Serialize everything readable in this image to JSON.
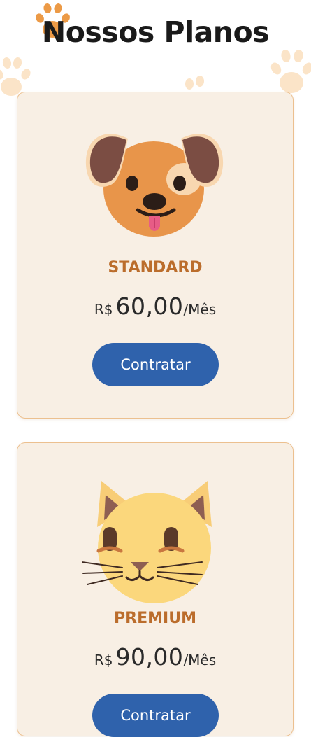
{
  "page": {
    "title": "Nossos Planos",
    "background_color": "#ffffff",
    "decorations": [
      "paw-print-icon",
      "paw-print-icon",
      "paw-print-icon",
      "paw-print-icon"
    ]
  },
  "plans": [
    {
      "icon": "dog-face-icon",
      "name": "STANDARD",
      "currency": "R$",
      "price": "60,00",
      "period": "/Mês",
      "button_label": "Contratar"
    },
    {
      "icon": "cat-face-icon",
      "name": "PREMIUM",
      "currency": "R$",
      "price": "90,00",
      "period": "/Mês",
      "button_label": "Contratar"
    }
  ],
  "colors": {
    "card_background": "#f8efe4",
    "card_border": "#ecc08f",
    "plan_name": "#bb6d2c",
    "button": "#2f62ac",
    "button_text": "#ffffff",
    "paw_orange": "#ec9a46",
    "paw_light": "#fbe4c8"
  }
}
